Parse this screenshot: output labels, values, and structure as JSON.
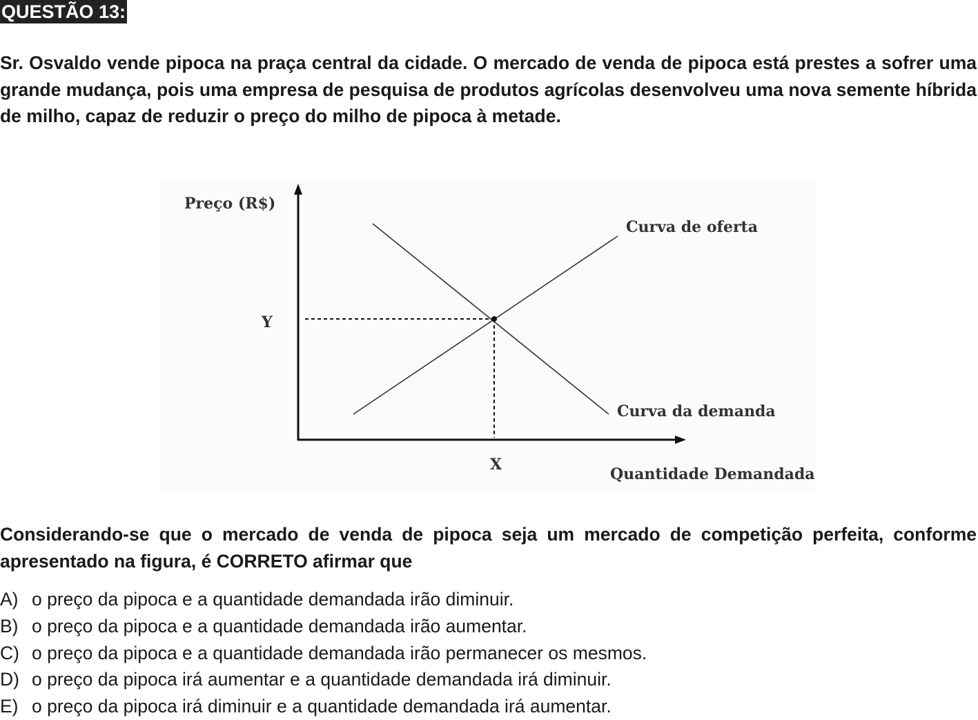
{
  "header": {
    "title": "QUESTÃO 13:"
  },
  "intro": "Sr. Osvaldo vende pipoca na praça central da cidade. O mercado de venda de pipoca está prestes a sofrer uma grande mudança, pois uma empresa de pesquisa de produtos agrícolas desenvolveu uma nova semente híbrida de milho, capaz de reduzir o preço do milho de pipoca à metade.",
  "figure": {
    "y_axis_label": "Preço (R$)",
    "x_axis_label": "Quantidade Demandada",
    "supply_label": "Curva de oferta",
    "demand_label": "Curva da demanda",
    "equilibrium_price_label": "Y",
    "equilibrium_quantity_label": "X"
  },
  "chart_data": {
    "type": "line",
    "ylabel": "Preço (R$)",
    "xlabel": "Quantidade Demandada",
    "series": [
      {
        "name": "Curva de oferta",
        "points": [
          [
            0.15,
            0.12
          ],
          [
            0.85,
            0.85
          ]
        ]
      },
      {
        "name": "Curva da demanda",
        "points": [
          [
            0.2,
            0.85
          ],
          [
            0.82,
            0.12
          ]
        ]
      }
    ],
    "equilibrium": {
      "x": "X",
      "y": "Y"
    },
    "grid": false
  },
  "question_text": "Considerando-se que o mercado de venda de pipoca seja um mercado de competição perfeita, conforme apresentado na figura, é CORRETO afirmar que",
  "options": [
    {
      "letter": "A)",
      "text": "o preço da pipoca e a quantidade demandada irão diminuir."
    },
    {
      "letter": "B)",
      "text": "o preço da pipoca e a quantidade demandada irão aumentar."
    },
    {
      "letter": "C)",
      "text": "o preço da pipoca e a quantidade demandada irão permanecer os mesmos."
    },
    {
      "letter": "D)",
      "text": "o preço da pipoca irá aumentar e a quantidade demandada irá diminuir."
    },
    {
      "letter": "E)",
      "text": "o preço da pipoca irá diminuir e a quantidade demandada irá aumentar."
    }
  ]
}
